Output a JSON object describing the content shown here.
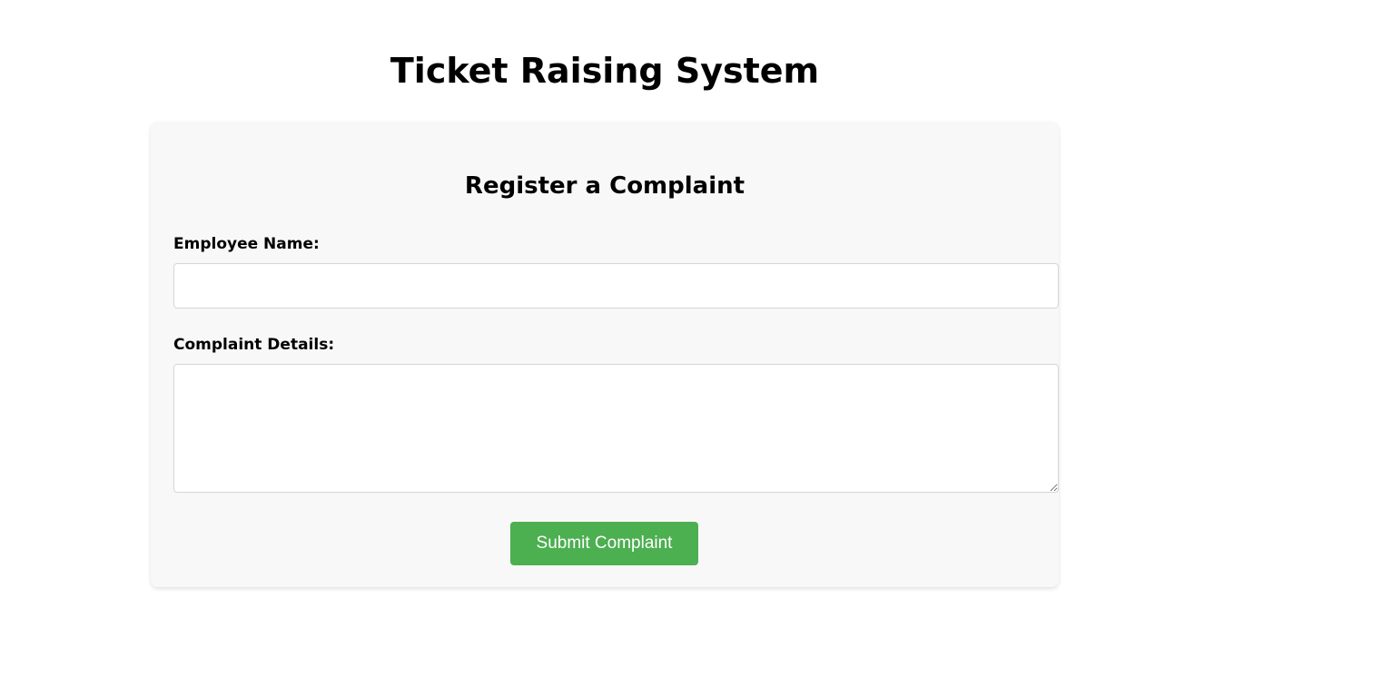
{
  "header": {
    "title": "Ticket Raising System"
  },
  "form": {
    "title": "Register a Complaint",
    "name_label": "Employee Name:",
    "name_value": "",
    "details_label": "Complaint Details:",
    "details_value": "",
    "submit_label": "Submit Complaint",
    "submit_color": "#4caf50"
  }
}
